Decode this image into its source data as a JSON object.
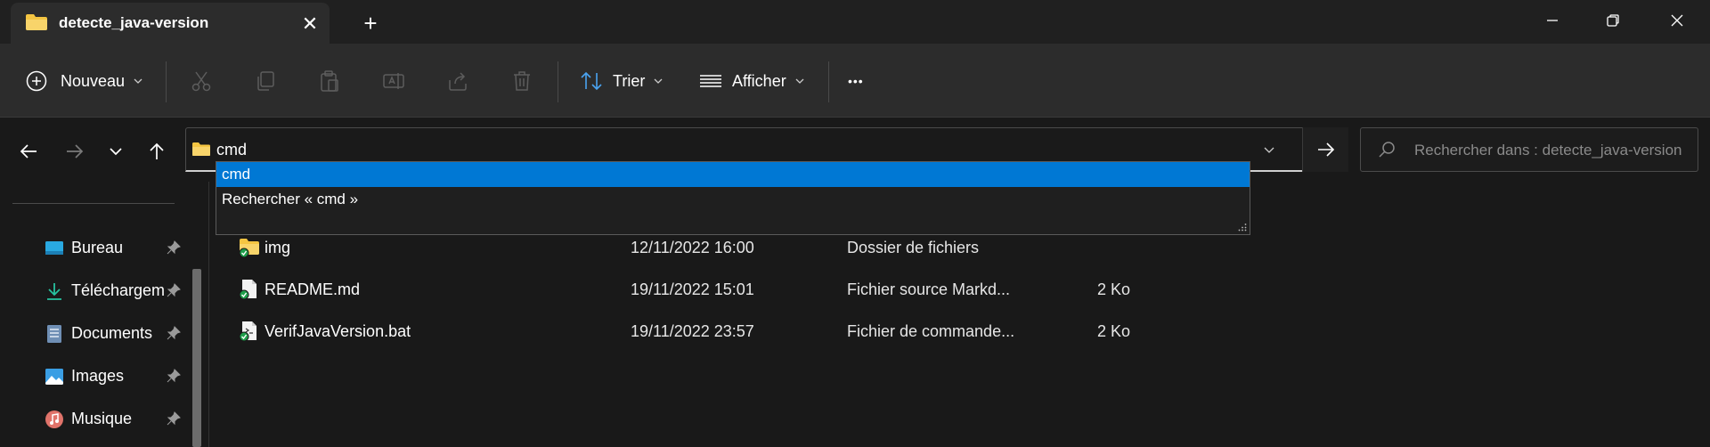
{
  "window": {
    "tab_title": "detecte_java-version",
    "new_tab": "+",
    "close_tab": "✕"
  },
  "toolbar": {
    "new_label": "Nouveau",
    "sort_label": "Trier",
    "view_label": "Afficher",
    "more": "•••"
  },
  "address": {
    "value": "cmd",
    "suggestions": [
      {
        "label": "cmd",
        "selected": true
      },
      {
        "label": "Rechercher « cmd »",
        "selected": false
      }
    ]
  },
  "search": {
    "placeholder": "Rechercher dans : detecte_java-version"
  },
  "sidebar": {
    "items": [
      {
        "label": "Bureau",
        "icon": "desktop-icon",
        "pinned": true
      },
      {
        "label": "Téléchargements",
        "icon": "download-icon",
        "pinned": true
      },
      {
        "label": "Documents",
        "icon": "documents-icon",
        "pinned": true
      },
      {
        "label": "Images",
        "icon": "pictures-icon",
        "pinned": true
      },
      {
        "label": "Musique",
        "icon": "music-icon",
        "pinned": true
      }
    ]
  },
  "files": [
    {
      "name": "img",
      "modified": "12/11/2022 16:00",
      "type": "Dossier de fichiers",
      "size": "",
      "icon": "folder-icon"
    },
    {
      "name": "README.md",
      "modified": "19/11/2022 15:01",
      "type": "Fichier source Markd...",
      "size": "2 Ko",
      "icon": "file-icon"
    },
    {
      "name": "VerifJavaVersion.bat",
      "modified": "19/11/2022 23:57",
      "type": "Fichier de commande...",
      "size": "2 Ko",
      "icon": "file-icon"
    }
  ],
  "colors": {
    "accent": "#0078d4",
    "folder": "#f4c542",
    "sync_ok": "#1e9e4a"
  }
}
